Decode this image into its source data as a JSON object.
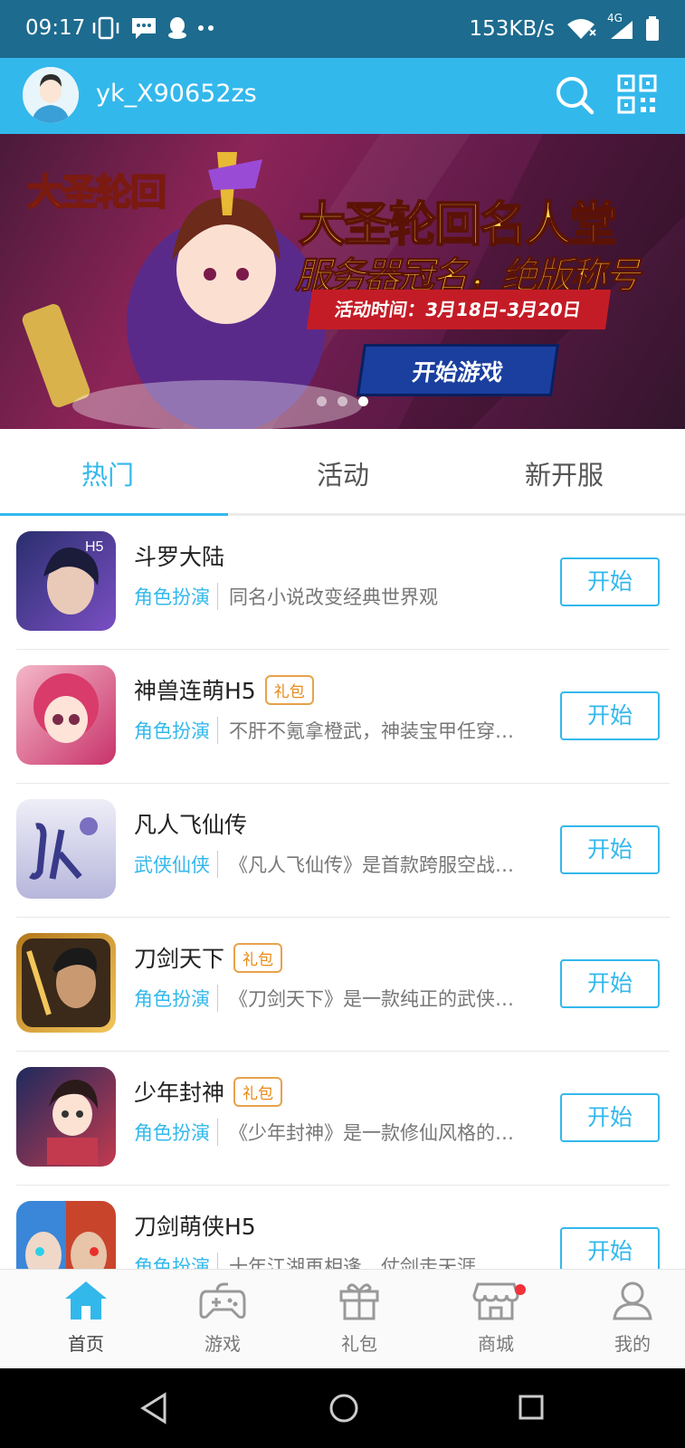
{
  "status_bar": {
    "time": "09:17",
    "speed": "153KB/s",
    "network": "4G"
  },
  "header": {
    "username": "yk_X90652zs"
  },
  "banner": {
    "logo_text": "大圣轮回",
    "title": "大圣轮回名人堂",
    "subtitle": "服务器冠名，绝版称号",
    "time_text": "活动时间：3月18日-3月20日",
    "button_label": "开始游戏",
    "slides": 3,
    "active_slide": 3
  },
  "tabs": [
    {
      "label": "热门",
      "active": true
    },
    {
      "label": "活动",
      "active": false
    },
    {
      "label": "新开服",
      "active": false
    }
  ],
  "games": [
    {
      "name": "斗罗大陆",
      "badge": "",
      "category": "角色扮演",
      "desc": "同名小说改变经典世界观",
      "button": "开始",
      "icon_colors": [
        "#2a2f6e",
        "#7a4fc4"
      ]
    },
    {
      "name": "神兽连萌H5",
      "badge": "礼包",
      "category": "角色扮演",
      "desc": "不肝不氪拿橙武，神装宝甲任穿…",
      "button": "开始",
      "icon_colors": [
        "#f4b7c8",
        "#c8336a"
      ]
    },
    {
      "name": "凡人飞仙传",
      "badge": "",
      "category": "武侠仙侠",
      "desc": "《凡人飞仙传》是首款跨服空战…",
      "button": "开始",
      "icon_colors": [
        "#eeeef8",
        "#b7b6dc"
      ]
    },
    {
      "name": "刀剑天下",
      "badge": "礼包",
      "category": "角色扮演",
      "desc": "《刀剑天下》是一款纯正的武侠…",
      "button": "开始",
      "icon_colors": [
        "#b4781c",
        "#f3c65a"
      ]
    },
    {
      "name": "少年封神",
      "badge": "礼包",
      "category": "角色扮演",
      "desc": "《少年封神》是一款修仙风格的…",
      "button": "开始",
      "icon_colors": [
        "#1e2a5e",
        "#c33a4e"
      ]
    },
    {
      "name": "刀剑萌侠H5",
      "badge": "",
      "category": "角色扮演",
      "desc": "十年江湖再相逢，仗剑走天涯…",
      "button": "开始",
      "icon_colors": [
        "#3a86d8",
        "#c8452c"
      ]
    }
  ],
  "bottom_nav": [
    {
      "label": "首页",
      "icon": "home-icon",
      "active": true
    },
    {
      "label": "游戏",
      "icon": "gamepad-icon",
      "active": false
    },
    {
      "label": "礼包",
      "icon": "gift-icon",
      "active": false
    },
    {
      "label": "商城",
      "icon": "store-icon",
      "active": false,
      "has_dot": true
    },
    {
      "label": "我的",
      "icon": "user-icon",
      "active": false
    }
  ],
  "colors": {
    "accent": "#33b8ec",
    "status_bar": "#1d6b8f",
    "badge": "#e78a17",
    "notification_dot": "#f2313a"
  }
}
